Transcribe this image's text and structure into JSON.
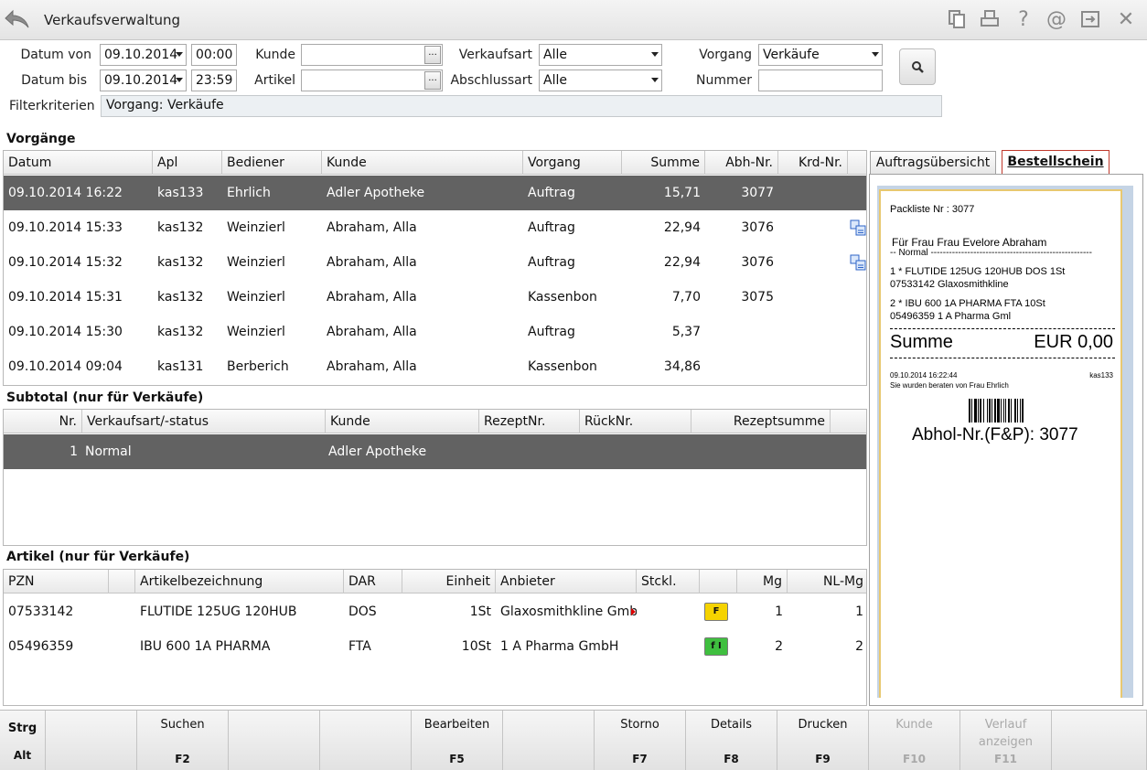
{
  "window": {
    "title": "Verkaufsverwaltung"
  },
  "filters": {
    "datum_von_label": "Datum von",
    "datum_von": "09.10.2014",
    "zeit_von": "00:00",
    "datum_bis_label": "Datum bis",
    "datum_bis": "09.10.2014",
    "zeit_bis": "23:59",
    "kunde_label": "Kunde",
    "kunde": "",
    "artikel_label": "Artikel",
    "artikel": "",
    "verkaufsart_label": "Verkaufsart",
    "verkaufsart": "Alle",
    "abschlussart_label": "Abschlussart",
    "abschlussart": "Alle",
    "vorgang_label": "Vorgang",
    "vorgang": "Verkäufe",
    "nummer_label": "Nummer",
    "nummer": "",
    "filterkriterien_label": "Filterkriterien",
    "filterkriterien": "Vorgang: Verkäufe",
    "dots": "..."
  },
  "vorgaenge": {
    "title": "Vorgänge",
    "columns": [
      "Datum",
      "Apl",
      "Bediener",
      "Kunde",
      "Vorgang",
      "Summe",
      "Abh-Nr.",
      "Krd-Nr."
    ],
    "rows": [
      [
        "09.10.2014 16:22",
        "kas133",
        "Ehrlich",
        "Adler Apotheke",
        "Auftrag",
        "15,71",
        "3077",
        ""
      ],
      [
        "09.10.2014 15:33",
        "kas132",
        "Weinzierl",
        "Abraham, Alla",
        "Auftrag",
        "22,94",
        "3076",
        ""
      ],
      [
        "09.10.2014 15:32",
        "kas132",
        "Weinzierl",
        "Abraham, Alla",
        "Auftrag",
        "22,94",
        "3076",
        ""
      ],
      [
        "09.10.2014 15:31",
        "kas132",
        "Weinzierl",
        "Abraham, Alla",
        "Kassenbon",
        "7,70",
        "3075",
        ""
      ],
      [
        "09.10.2014 15:30",
        "kas132",
        "Weinzierl",
        "Abraham, Alla",
        "Auftrag",
        "5,37",
        "",
        ""
      ],
      [
        "09.10.2014 09:04",
        "kas131",
        "Berberich",
        "Abraham, Alla",
        "Kassenbon",
        "34,86",
        "",
        ""
      ]
    ]
  },
  "subtotal": {
    "title": "Subtotal (nur für Verkäufe)",
    "columns": [
      "Nr.",
      "Verkaufsart/-status",
      "Kunde",
      "RezeptNr.",
      "RückNr.",
      "Rezeptsumme"
    ],
    "rows": [
      [
        "1",
        "Normal",
        "Adler Apotheke",
        "",
        "",
        ""
      ]
    ]
  },
  "artikel": {
    "title": "Artikel (nur für Verkäufe)",
    "columns": [
      "PZN",
      "",
      "Artikelbezeichnung",
      "DAR",
      "Einheit",
      "Anbieter",
      "Stckl.",
      "",
      "Mg",
      "NL-Mg"
    ],
    "rows": [
      [
        "07533142",
        "",
        "FLUTIDE 125UG 120HUB",
        "DOS",
        "1St",
        "Glaxosmithkline GmbH",
        "",
        "F",
        "1",
        "1"
      ],
      [
        "05496359",
        "",
        "IBU 600 1A PHARMA",
        "FTA",
        "10St",
        "1 A Pharma GmbH",
        "",
        "f I",
        "2",
        "2"
      ]
    ]
  },
  "tabs": {
    "auftrag": "Auftragsübersicht",
    "bestell": "Bestellschein"
  },
  "receipt": {
    "packliste": "Packliste Nr : 3077",
    "fuer": "Für Frau  Frau Evelore  Abraham",
    "normal": "-- Normal -----------------------------------------------------",
    "item1a": "1 * FLUTIDE 125UG 120HUB DOS 1St",
    "item1b": "07533142  Glaxosmithkline",
    "item2a": "2 * IBU 600 1A PHARMA FTA 10St",
    "item2b": "05496359  1 A Pharma Gml",
    "summe_label": "Summe",
    "summe_value": "EUR  0,00",
    "datetime": "09.10.2014 16:22:44",
    "apl": "kas133",
    "beraten": "Sie wurden beraten von Frau Ehrlich",
    "abhol": "Abhol-Nr.(F&P): 3077"
  },
  "fkeys": [
    {
      "label": "Strg",
      "key": "Alt"
    },
    {
      "label": "",
      "key": ""
    },
    {
      "label": "Suchen",
      "key": "F2"
    },
    {
      "label": "",
      "key": ""
    },
    {
      "label": "",
      "key": ""
    },
    {
      "label": "Bearbeiten",
      "key": "F5"
    },
    {
      "label": "",
      "key": ""
    },
    {
      "label": "Storno",
      "key": "F7"
    },
    {
      "label": "Details",
      "key": "F8"
    },
    {
      "label": "Drucken",
      "key": "F9"
    },
    {
      "label": "Kunde",
      "key": "F10"
    },
    {
      "label": "Verlauf anzeigen",
      "key": "F11"
    },
    {
      "label": "",
      "key": ""
    }
  ],
  "colors": {
    "selected_row": "#626262",
    "tab_active_border": "#c0392b",
    "receipt_border": "#e8c870"
  }
}
